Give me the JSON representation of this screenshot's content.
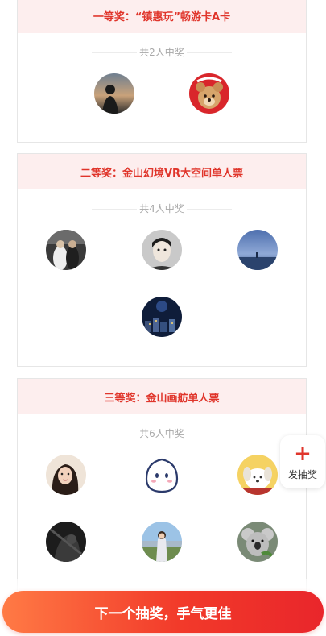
{
  "prizes": [
    {
      "title": "一等奖：“镇惠玩”畅游卡A卡",
      "winners_text": "共2人中奖",
      "winners": [
        {
          "avatar": "silhouette-sunset-avatar"
        },
        {
          "avatar": "bear-plush-avatar"
        }
      ]
    },
    {
      "title": "二等奖：金山幻境VR大空间单人票",
      "winners_text": "共4人中奖",
      "winners": [
        {
          "avatar": "couple-photo-avatar"
        },
        {
          "avatar": "bearded-man-sketch-avatar"
        },
        {
          "avatar": "blue-sky-avatar"
        },
        {
          "avatar": "night-city-avatar"
        }
      ]
    },
    {
      "title": "三等奖：金山画舫单人票",
      "winners_text": "共6人中奖",
      "winners": [
        {
          "avatar": "woman-portrait-avatar"
        },
        {
          "avatar": "cute-face-avatar"
        },
        {
          "avatar": "puppy-cartoon-avatar"
        },
        {
          "avatar": "dark-photo-avatar"
        },
        {
          "avatar": "girl-outdoor-avatar"
        },
        {
          "avatar": "koala-avatar"
        }
      ]
    }
  ],
  "float_button": {
    "icon": "plus-icon",
    "label": "发抽奖"
  },
  "cta": {
    "label": "下一个抽奖，手气更佳"
  },
  "colors": {
    "accent": "#e0352b",
    "header_bg": "#fdeeee",
    "cta_start": "#ff7a45",
    "cta_end": "#e9262b"
  }
}
